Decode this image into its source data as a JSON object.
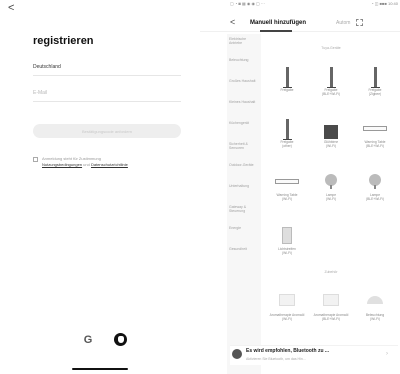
{
  "left": {
    "back": "<",
    "title": "registrieren",
    "country": "Deutschland",
    "email_placeholder": "E-Mail",
    "button": "Bestätigungscode anfordern",
    "agree_prefix": "Anmeldung steht für Zustimmung",
    "agree_link1": "Nutzungsbedingungen",
    "agree_mid": "und",
    "agree_link2": "Datenschutzrichtlinie",
    "google": "G"
  },
  "right": {
    "status_left": "▢ ◔ ◙ ▦ ◉ ◉ ▢ ···",
    "status_right": "◔ ◫ ■■■ 10:40",
    "back": "<",
    "tab_manual": "Manuell hinzufügen",
    "tab_auto": "Autom",
    "sidebar": [
      "Elektrische Antriebe",
      "Beleuchtung",
      "Großes Haushalt",
      "Kleines Haushalt",
      "Küchengerät",
      "Sicherheit & Sensoren",
      "Outdoor-Geräte",
      "Unterhaltung",
      "Gateway & Steuerung",
      "Energie",
      "Gesundheit"
    ],
    "section1": "Tuya-Geräte",
    "devices1": [
      {
        "name": "Freigabe",
        "sub": ""
      },
      {
        "name": "Freigabe",
        "sub": "(BLE+Wi-Fi)"
      },
      {
        "name": "Freigabe",
        "sub": "(Zigbee)"
      },
      {
        "name": "Freigabe",
        "sub": "(other)"
      },
      {
        "name": "Glühbirne",
        "sub": "(Wi-Fi)"
      },
      {
        "name": "Warning Table",
        "sub": "(BLE+Wi-Fi)"
      },
      {
        "name": "Warning Table",
        "sub": "(Wi-Fi)"
      },
      {
        "name": "Lampe",
        "sub": "(Wi-Fi)"
      },
      {
        "name": "Lampe",
        "sub": "(BLE+Wi-Fi)"
      },
      {
        "name": "Lichtstreifen",
        "sub": "(Wi-Fi)"
      }
    ],
    "section2": "Zubehör",
    "devices2": [
      {
        "name": "Aromatherapie Aromaöl",
        "sub": "(Wi-Fi)"
      },
      {
        "name": "Aromatherapie Aromaöl",
        "sub": "(BLE+Wi-Fi)"
      },
      {
        "name": "Beleuchtung",
        "sub": "(Wi-Fi)"
      }
    ],
    "banner_title": "Es wird empfohlen, Bluetooth zu ...",
    "banner_sub": "Aktivieren Sie Bluetooth, um das Hin...",
    "banner_arrow": "›"
  }
}
